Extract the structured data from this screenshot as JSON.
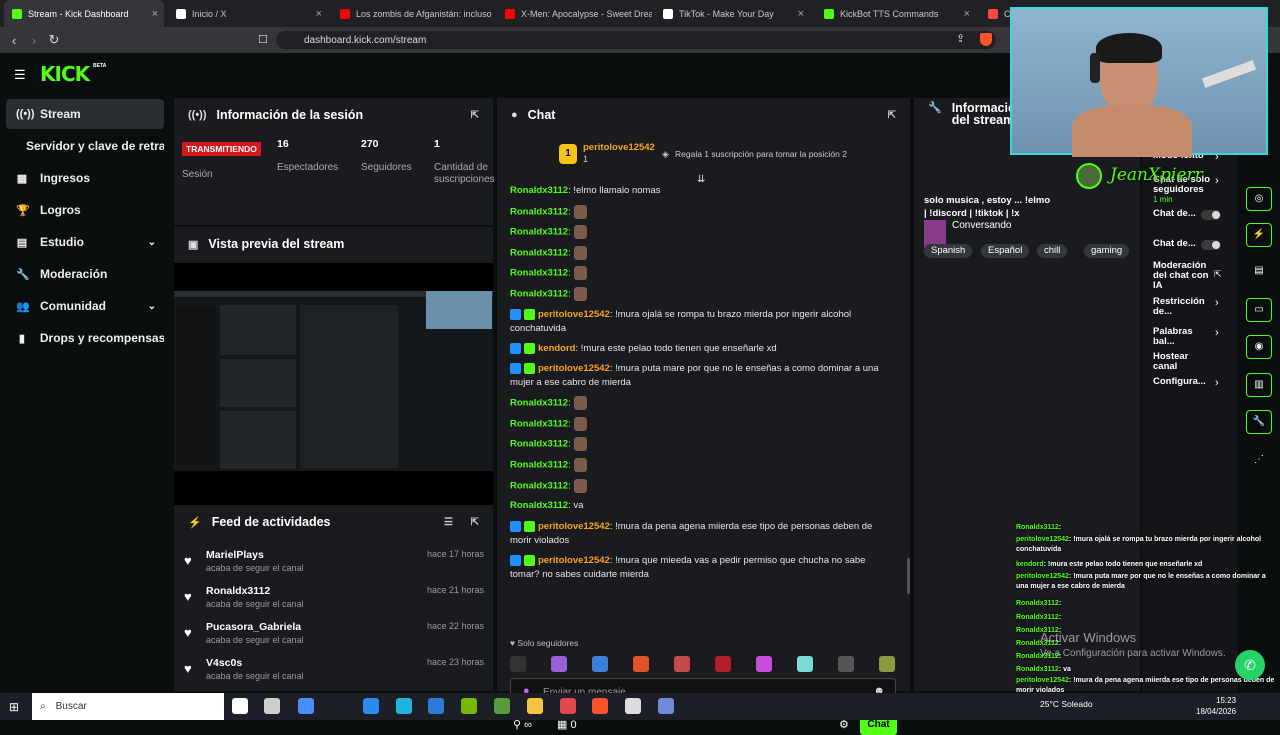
{
  "browser": {
    "tabs": [
      {
        "title": "Stream - Kick Dashboard",
        "active": true,
        "favicon_color": "#53fc18"
      },
      {
        "title": "Inicio / X",
        "favicon_color": "#ffffff"
      },
      {
        "title": "Los zombis de Afganistán: incluso lo",
        "favicon_color": "#ff0000"
      },
      {
        "title": "X-Men: Apocalypse - Sweet Dreams",
        "favicon_color": "#ff0000"
      },
      {
        "title": "TikTok - Make Your Day",
        "favicon_color": "#ffffff"
      },
      {
        "title": "KickBot TTS Commands",
        "favicon_color": "#53fc18"
      },
      {
        "title": "C",
        "favicon_color": "#ff4444"
      }
    ],
    "url": "dashboard.kick.com/stream"
  },
  "brand": {
    "logo": "KICK",
    "beta": "BETA",
    "accent": "#53fc18"
  },
  "sidebar": {
    "items": [
      {
        "label": "Stream",
        "icon": "broadcast-icon",
        "glyph": "((•))",
        "selected": true
      },
      {
        "label": "Servidor y clave de retransmisión",
        "icon": "",
        "glyph": ""
      },
      {
        "label": "Ingresos",
        "icon": "table-icon",
        "glyph": "▦"
      },
      {
        "label": "Logros",
        "icon": "trophy-icon",
        "glyph": "🏆"
      },
      {
        "label": "Estudio",
        "icon": "grid-icon",
        "glyph": "▤",
        "chevron": true
      },
      {
        "label": "Moderación",
        "icon": "wrench-icon",
        "glyph": "🔧"
      },
      {
        "label": "Comunidad",
        "icon": "users-icon",
        "glyph": "👥",
        "chevron": true
      },
      {
        "label": "Drops y recompensas",
        "icon": "chart-icon",
        "glyph": "▮"
      }
    ]
  },
  "session": {
    "title": "Información de la sesión",
    "live_badge": "TRANSMITIENDO",
    "live_label": "Sesión",
    "stats": [
      {
        "value": "16",
        "label": "Espectadores"
      },
      {
        "value": "270",
        "label": "Seguidores"
      },
      {
        "value": "1",
        "label": "Cantidad de suscripciones"
      }
    ]
  },
  "preview": {
    "title": "Vista previa del stream"
  },
  "feed": {
    "title": "Feed de actividades",
    "items": [
      {
        "name": "MarielPlays",
        "action": "acaba de seguir el canal",
        "time": "hace 17 horas"
      },
      {
        "name": "Ronaldx3112",
        "action": "acaba de seguir el canal",
        "time": "hace 21 horas"
      },
      {
        "name": "Pucasora_Gabriela",
        "action": "acaba de seguir el canal",
        "time": "hace 22 horas"
      },
      {
        "name": "V4sc0s",
        "action": "acaba de seguir el canal",
        "time": "hace 23 horas"
      }
    ]
  },
  "chat": {
    "title": "Chat",
    "top_gifter": {
      "name": "peritolove12542",
      "rank": "1",
      "count": "1",
      "note": "Regala 1 suscripción para tomar la posición 2"
    },
    "messages": [
      {
        "user": "Ronaldx3112",
        "text": ": !elmo llamalo nomas",
        "color": "#53fc18"
      },
      {
        "user": "Ronaldx3112",
        "text": ":",
        "emote": true,
        "color": "#53fc18"
      },
      {
        "user": "Ronaldx3112",
        "text": ":",
        "emote": true,
        "color": "#53fc18"
      },
      {
        "user": "Ronaldx3112",
        "text": ":",
        "emote": true,
        "color": "#53fc18"
      },
      {
        "user": "Ronaldx3112",
        "text": ":",
        "emote": true,
        "color": "#53fc18"
      },
      {
        "user": "Ronaldx3112",
        "text": ":",
        "emote": true,
        "color": "#53fc18"
      },
      {
        "user": "peritolove12542",
        "text": ": !mura ojalá se rompa tu brazo mierda por ingerir alcohol conchatuvida",
        "color": "#f5a623",
        "badges": true
      },
      {
        "user": "kendord",
        "text": ": !mura este pelao todo tienen que enseñarle xd",
        "color": "#f5a623",
        "badges": true
      },
      {
        "user": "peritolove12542",
        "text": ": !mura puta mare por que no le enseñas a como dominar a una mujer a ese cabro de mierda",
        "color": "#f5a623",
        "badges": true
      },
      {
        "user": "Ronaldx3112",
        "text": ":",
        "emote": true,
        "color": "#53fc18"
      },
      {
        "user": "Ronaldx3112",
        "text": ":",
        "emote": true,
        "color": "#53fc18"
      },
      {
        "user": "Ronaldx3112",
        "text": ":",
        "emote": true,
        "color": "#53fc18"
      },
      {
        "user": "Ronaldx3112",
        "text": ":",
        "emote": true,
        "color": "#53fc18"
      },
      {
        "user": "Ronaldx3112",
        "text": ":",
        "emote": true,
        "color": "#53fc18"
      },
      {
        "user": "Ronaldx3112",
        "text": ": va",
        "color": "#53fc18"
      },
      {
        "user": "peritolove12542",
        "text": ": !mura da pena agena miierda ese tipo de personas deben de morir violados",
        "color": "#f5a623",
        "badges": true
      },
      {
        "user": "peritolove12542",
        "text": ": !mura que mieeda vas a pedir permiso que chucha no sabe tomar? no sabes cuidarte mierda",
        "color": "#f5a623",
        "badges": true
      }
    ],
    "followers_only": "Solo seguidores",
    "input_placeholder": "Enviar un mensaje",
    "send_label": "Chat",
    "viewer_count": "∞",
    "gift_count": "0"
  },
  "stream_info": {
    "title": "Información del stream",
    "description": "solo musica , estoy ... !elmo | !discord | !tiktok | !x",
    "category": "Conversando",
    "tags": [
      "Spanish",
      "Español",
      "chill",
      "gaming"
    ]
  },
  "settings": {
    "items": [
      {
        "label": "Modo lento",
        "control": "chevron"
      },
      {
        "label": "Chat de solo seguidores",
        "sub": "1 min",
        "control": "chevron"
      },
      {
        "label": "Chat de...",
        "control": "toggle"
      },
      {
        "label": "Chat de...",
        "control": "toggle"
      },
      {
        "label": "Moderación del chat con IA",
        "control": "external"
      },
      {
        "label": "Restricción de...",
        "control": "chevron"
      },
      {
        "label": "Palabras bal...",
        "control": "chevron"
      },
      {
        "label": "Hostear canal",
        "control": "none"
      },
      {
        "label": "Configura...",
        "control": "chevron"
      }
    ]
  },
  "webcam_watermark": "JeanXpierr",
  "overlay_chat": [
    {
      "user": "Ronaldx3112",
      "text": ":"
    },
    {
      "user": "peritolove12542",
      "text": ": !mura ojalá se rompa tu brazo mierda por ingerir alcohol conchatuvida"
    },
    {
      "user": "kendord",
      "text": ": !mura este pelao todo tienen que enseñarle xd"
    },
    {
      "user": "peritolove12542",
      "text": ": !mura puta mare por que no le enseñas a como dominar a una mujer a ese cabro de mierda"
    },
    {
      "user": "Ronaldx3112",
      "text": ":"
    },
    {
      "user": "Ronaldx3112",
      "text": ":"
    },
    {
      "user": "Ronaldx3112",
      "text": ":"
    },
    {
      "user": "Ronaldx3112",
      "text": ":"
    },
    {
      "user": "Ronaldx3112",
      "text": ":"
    },
    {
      "user": "Ronaldx3112",
      "text": ": va"
    },
    {
      "user": "peritolove12542",
      "text": ": !mura da pena agena miierda ese tipo de personas deben de morir violados"
    },
    {
      "user": "peritolove12542",
      "text": ": !mura que mieeda vas a pedir permiso que chucha no sabe tomar? no sabes cuidarte mierda"
    }
  ],
  "windows_activation": {
    "title": "Activar Windows",
    "subtitle": "Ve a Configuración para activar Windows."
  },
  "taskbar": {
    "search": "Buscar",
    "weather_temp": "25°C",
    "weather_text": "Soleado",
    "time": "15:23",
    "date": "18/04/2026"
  }
}
